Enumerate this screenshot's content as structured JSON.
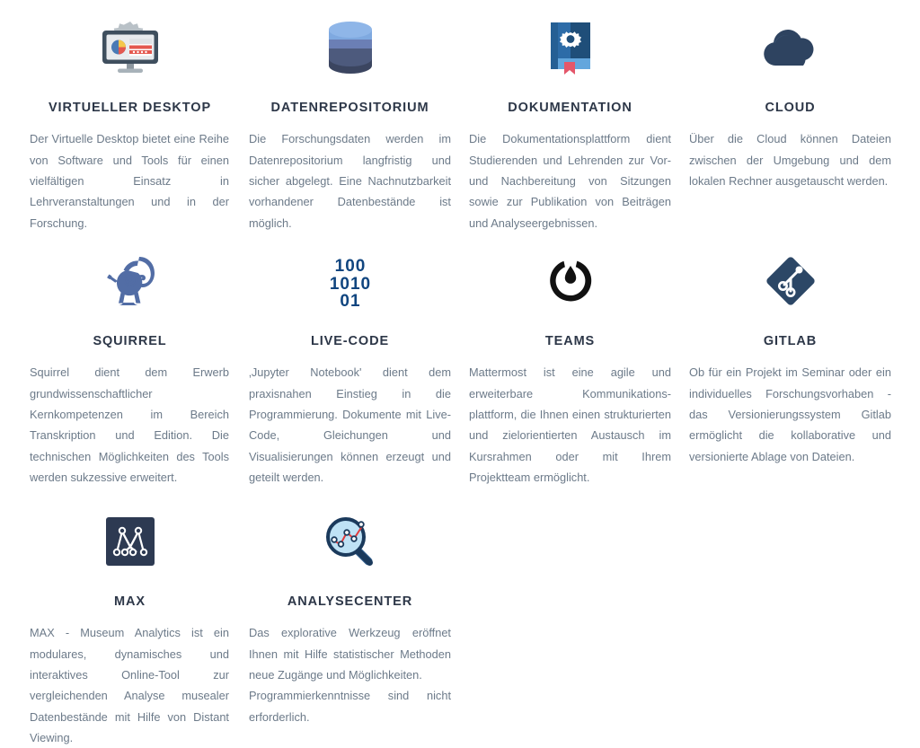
{
  "page": {
    "background": "#ffffff",
    "title_color": "#2d3748",
    "text_color": "#6c7a89"
  },
  "cards": [
    {
      "id": "virtueller-desktop",
      "icon": "monitor-gear-icon",
      "title": "VIRTUELLER DESKTOP",
      "description": "Der Virtuelle Desktop bietet eine Reihe von Software und Tools für einen vielfältigen Einsatz in Lehrveranstaltungen und in der Forschung."
    },
    {
      "id": "datenrepositorium",
      "icon": "database-icon",
      "title": "DATENREPOSITORIUM",
      "description": "Die Forschungsdaten werden im Datenrepositorium langfristig und sicher abgelegt. Eine Nachnutzbarkeit vorhandener Datenbestände ist möglich."
    },
    {
      "id": "dokumentation",
      "icon": "book-gear-icon",
      "title": "DOKUMENTATION",
      "description": "Die Dokumentationsplattform dient Studierenden und Lehrenden zur Vor- und Nachbereitung von Sitzungen sowie zur Publikation von Beiträgen und Analyseergebnissen."
    },
    {
      "id": "cloud",
      "icon": "cloud-icon",
      "title": "CLOUD",
      "description": "Über die Cloud können Dateien zwischen der Umgebung und dem lokalen Rechner ausgetauscht werden."
    },
    {
      "id": "squirrel",
      "icon": "squirrel-icon",
      "title": "SQUIRREL",
      "description": "Squirrel dient dem Erwerb grundwissenschaftlicher Kernkompetenzen im Bereich Transkription und Edition. Die technischen Möglichkeiten des Tools werden sukzessive erweitert."
    },
    {
      "id": "live-code",
      "icon": "binary-code-icon",
      "title": "LIVE-CODE",
      "description": "‚Jupyter Notebook' dient dem praxisnahen Einstieg in die Programmierung. Dokumente mit Live-Code, Gleichungen und Visualisierungen können erzeugt und geteilt werden."
    },
    {
      "id": "teams",
      "icon": "mattermost-icon",
      "title": "TEAMS",
      "description": "Mattermost ist eine agile und erweiterbare Kommunikations-plattform, die Ihnen einen strukturierten und zielorientierten Austausch im Kursrahmen oder mit Ihrem Projektteam ermöglicht."
    },
    {
      "id": "gitlab",
      "icon": "gitlab-diamond-icon",
      "title": "GITLAB",
      "description": "Ob für ein Projekt im Seminar oder ein individuelles Forschungsvorhaben - das Versionierungssystem Gitlab ermöglicht die kollaborative und versionierte Ablage von Dateien."
    },
    {
      "id": "max",
      "icon": "max-network-icon",
      "title": "MAX",
      "description": "MAX - Museum Analytics ist ein modulares, dynamisches und interaktives Online-Tool zur vergleichenden Analyse musealer Datenbestände mit Hilfe von Distant Viewing."
    },
    {
      "id": "analysecenter",
      "icon": "magnifier-chart-icon",
      "title": "ANALYSECENTER",
      "description": "Das explorative Werkzeug eröffnet Ihnen mit Hilfe statistischer Methoden neue Zugänge und Möglichkeiten.\nProgrammierkenntnisse sind nicht erforderlich."
    }
  ],
  "icon_colors": {
    "monitor_body": "#3f4f5e",
    "monitor_screen": "#e8ebee",
    "gear": "#b9c1c7",
    "pie_red": "#e4584f",
    "pie_yellow": "#f5c84c",
    "pie_blue": "#4a7ab5",
    "db_top": "#7fa9e0",
    "db_mid": "#6b7fb5",
    "db_low": "#4d5a7d",
    "db_base": "#3b4560",
    "book_dark": "#1f4e79",
    "book_mid": "#2d6ca8",
    "book_light": "#63a6dd",
    "bookmark": "#e4566a",
    "cloud": "#2e4360",
    "squirrel": "#3c5a9a",
    "binary": "#10457f",
    "mattermost": "#111111",
    "gitlab": "#2c4766",
    "max_bg": "#2d3a52",
    "magnifier_glass": "#bfe2f5",
    "magnifier_ring": "#1b3a5c",
    "magnifier_line": "#e23b3b"
  }
}
